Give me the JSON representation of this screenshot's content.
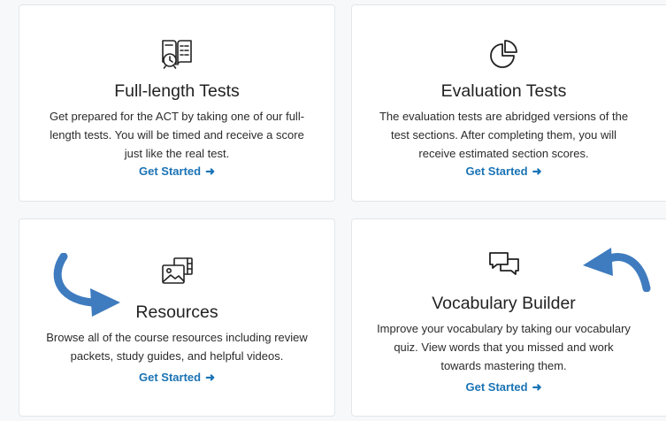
{
  "cards": [
    {
      "icon": "book-clock-icon",
      "title": "Full-length Tests",
      "description": "Get prepared for the ACT by taking one of our full-length tests. You will be timed and receive a score just like the real test.",
      "cta": "Get Started"
    },
    {
      "icon": "pie-chart-icon",
      "title": "Evaluation Tests",
      "description": "The evaluation tests are abridged versions of the test sections. After completing them, you will receive estimated section scores.",
      "cta": "Get Started"
    },
    {
      "icon": "media-gallery-icon",
      "title": "Resources",
      "description": "Browse all of the course resources including review packets, study guides, and helpful videos.",
      "cta": "Get Started"
    },
    {
      "icon": "chat-bubbles-icon",
      "title": "Vocabulary Builder",
      "description": "Improve your vocabulary by taking our vocabulary quiz. View words that you missed and work towards mastering them.",
      "cta": "Get Started"
    }
  ],
  "colors": {
    "accent": "#1a73b5",
    "annotation_arrow": "#3f7bbf",
    "background": "#f7f8f9",
    "card": "#ffffff"
  }
}
